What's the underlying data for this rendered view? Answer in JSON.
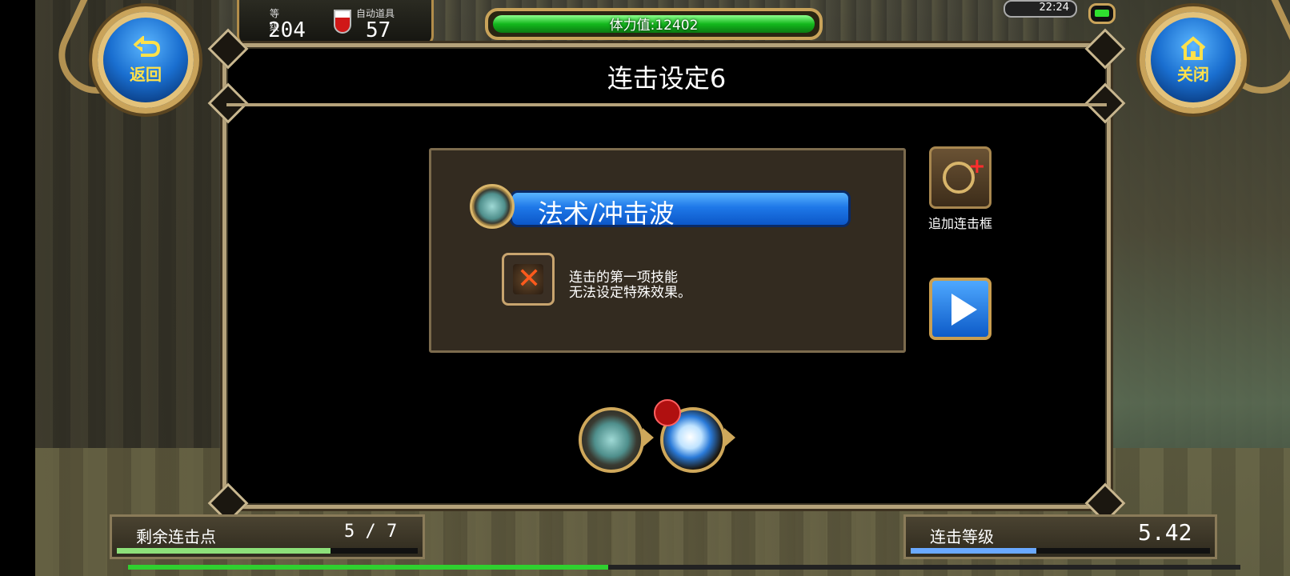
{
  "top_buttons": {
    "back_label": "返回",
    "close_label": "关闭"
  },
  "hud": {
    "level_label": "等级",
    "level_value": "204",
    "auto_item_label": "自动道具",
    "auto_item_value": "57",
    "stamina_text": "体力值:12402",
    "clock": "22:24"
  },
  "dialog": {
    "title": "连击设定6",
    "skill_name": "法术/冲击波",
    "note_line1": "连击的第一项技能",
    "note_line2": "无法设定特殊效果。",
    "add_label": "追加连击框"
  },
  "bottom": {
    "left_label": "剩余连击点",
    "left_value": "5 / 7",
    "left_progress": 0.71,
    "right_label": "连击等级",
    "right_value": "5.42",
    "right_progress": 0.42
  },
  "colors": {
    "accent_gold": "#c9a35a",
    "skill_blue": "#1e78e8",
    "stamina_green": "#13b81d"
  }
}
